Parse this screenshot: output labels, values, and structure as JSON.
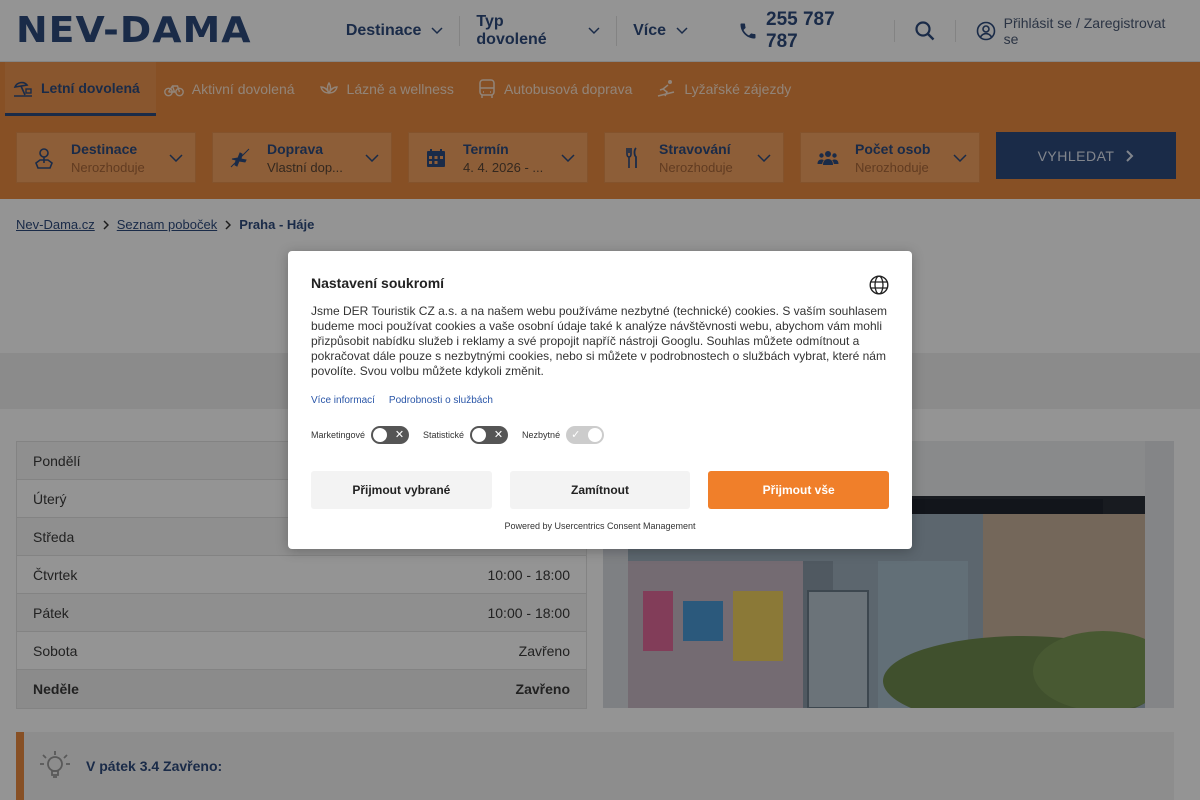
{
  "header": {
    "logo": "NEV-DAMA",
    "nav": [
      {
        "label": "Destinace"
      },
      {
        "label": "Typ dovolené"
      },
      {
        "label": "Více"
      }
    ],
    "phone": "255 787 787",
    "login": "Přihlásit se / Zaregistrovat se"
  },
  "tabs": [
    {
      "label": "Letní dovolená",
      "icon": "beach-umbrella-icon",
      "active": true
    },
    {
      "label": "Aktivní dovolená",
      "icon": "bicycle-icon"
    },
    {
      "label": "Lázně a wellness",
      "icon": "spa-icon"
    },
    {
      "label": "Autobusová doprava",
      "icon": "bus-icon"
    },
    {
      "label": "Lyžařské zájezdy",
      "icon": "skier-icon"
    }
  ],
  "filters": [
    {
      "label": "Destinace",
      "value": "Nerozhoduje",
      "icon": "map-pin-icon"
    },
    {
      "label": "Doprava",
      "value": "Vlastní dop...",
      "icon": "airplane-icon"
    },
    {
      "label": "Termín",
      "value": "4. 4. 2026 - ...",
      "icon": "calendar-icon"
    },
    {
      "label": "Stravování",
      "value": "Nerozhoduje",
      "icon": "cutlery-icon"
    },
    {
      "label": "Počet osob",
      "value": "Nerozhoduje",
      "icon": "people-icon"
    }
  ],
  "search_button": "VYHLEDAT",
  "breadcrumb": {
    "items": [
      "Nev-Dama.cz",
      "Seznam poboček"
    ],
    "current": "Praha - Háje"
  },
  "hours": [
    {
      "day": "Pondělí",
      "time": ""
    },
    {
      "day": "Úterý",
      "time": ""
    },
    {
      "day": "Středa",
      "time": ""
    },
    {
      "day": "Čtvrtek",
      "time": "10:00 - 18:00"
    },
    {
      "day": "Pátek",
      "time": "10:00 - 18:00"
    },
    {
      "day": "Sobota",
      "time": "Zavřeno"
    },
    {
      "day": "Neděle",
      "time": "Zavřeno"
    }
  ],
  "notice": "V pátek 3.4 Zavřeno:",
  "consent": {
    "title": "Nastavení soukromí",
    "text": "Jsme DER Touristik CZ a.s. a na našem webu používáme nezbytné (technické) cookies. S vaším souhlasem budeme moci používat cookies a vaše osobní údaje také k analýze návštěvnosti webu, abychom vám mohli přizpůsobit nabídku služeb i reklamy a své propojit napříč nástroji Googlu. Souhlas můžete odmítnout a pokračovat dále pouze s nezbytnými cookies, nebo si můžete v podrobnostech o službách vybrat, které nám povolíte. Svou volbu můžete kdykoli změnit.",
    "link_more": "Více informací",
    "link_details": "Podrobnosti o službách",
    "toggles": [
      {
        "label": "Marketingové",
        "state": "off"
      },
      {
        "label": "Statistické",
        "state": "off"
      },
      {
        "label": "Nezbytné",
        "state": "on"
      }
    ],
    "btn_selected": "Přijmout vybrané",
    "btn_reject": "Zamítnout",
    "btn_accept_all": "Přijmout vše",
    "powered_by": "Powered by Usercentrics Consent Management"
  },
  "colors": {
    "brand_blue": "#2e4a7d",
    "brand_orange": "#e98b40",
    "accept_orange": "#f07f2a"
  }
}
